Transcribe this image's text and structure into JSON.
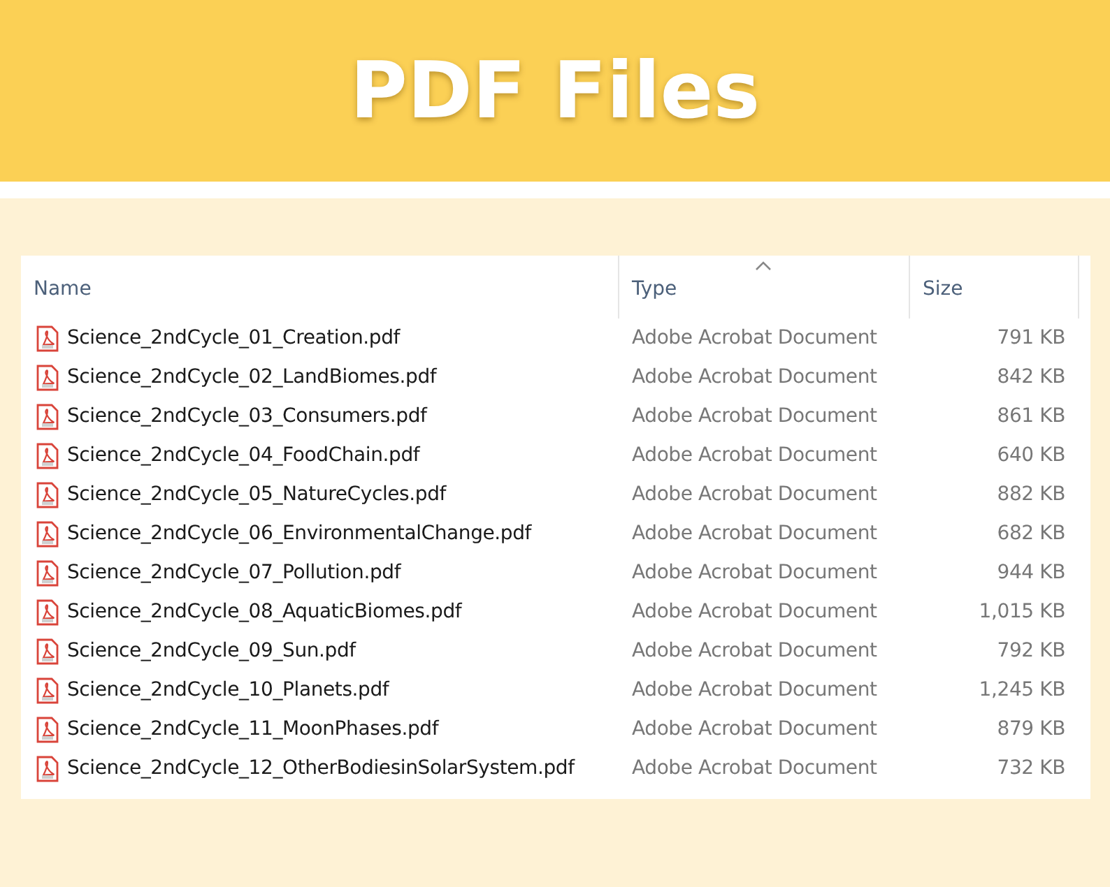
{
  "banner": {
    "title": "PDF Files"
  },
  "table": {
    "columns": [
      {
        "label": "Name",
        "sorted": false
      },
      {
        "label": "Type",
        "sorted": true
      },
      {
        "label": "Size",
        "sorted": false
      }
    ],
    "rows": [
      {
        "name": "Science_2ndCycle_01_Creation.pdf",
        "type": "Adobe Acrobat Document",
        "size": "791 KB"
      },
      {
        "name": "Science_2ndCycle_02_LandBiomes.pdf",
        "type": "Adobe Acrobat Document",
        "size": "842 KB"
      },
      {
        "name": "Science_2ndCycle_03_Consumers.pdf",
        "type": "Adobe Acrobat Document",
        "size": "861 KB"
      },
      {
        "name": "Science_2ndCycle_04_FoodChain.pdf",
        "type": "Adobe Acrobat Document",
        "size": "640 KB"
      },
      {
        "name": "Science_2ndCycle_05_NatureCycles.pdf",
        "type": "Adobe Acrobat Document",
        "size": "882 KB"
      },
      {
        "name": "Science_2ndCycle_06_EnvironmentalChange.pdf",
        "type": "Adobe Acrobat Document",
        "size": "682 KB"
      },
      {
        "name": "Science_2ndCycle_07_Pollution.pdf",
        "type": "Adobe Acrobat Document",
        "size": "944 KB"
      },
      {
        "name": "Science_2ndCycle_08_AquaticBiomes.pdf",
        "type": "Adobe Acrobat Document",
        "size": "1,015 KB"
      },
      {
        "name": "Science_2ndCycle_09_Sun.pdf",
        "type": "Adobe Acrobat Document",
        "size": "792 KB"
      },
      {
        "name": "Science_2ndCycle_10_Planets.pdf",
        "type": "Adobe Acrobat Document",
        "size": "1,245 KB"
      },
      {
        "name": "Science_2ndCycle_11_MoonPhases.pdf",
        "type": "Adobe Acrobat Document",
        "size": "879 KB"
      },
      {
        "name": "Science_2ndCycle_12_OtherBodiesinSolarSystem.pdf",
        "type": "Adobe Acrobat Document",
        "size": "732 KB"
      }
    ]
  }
}
